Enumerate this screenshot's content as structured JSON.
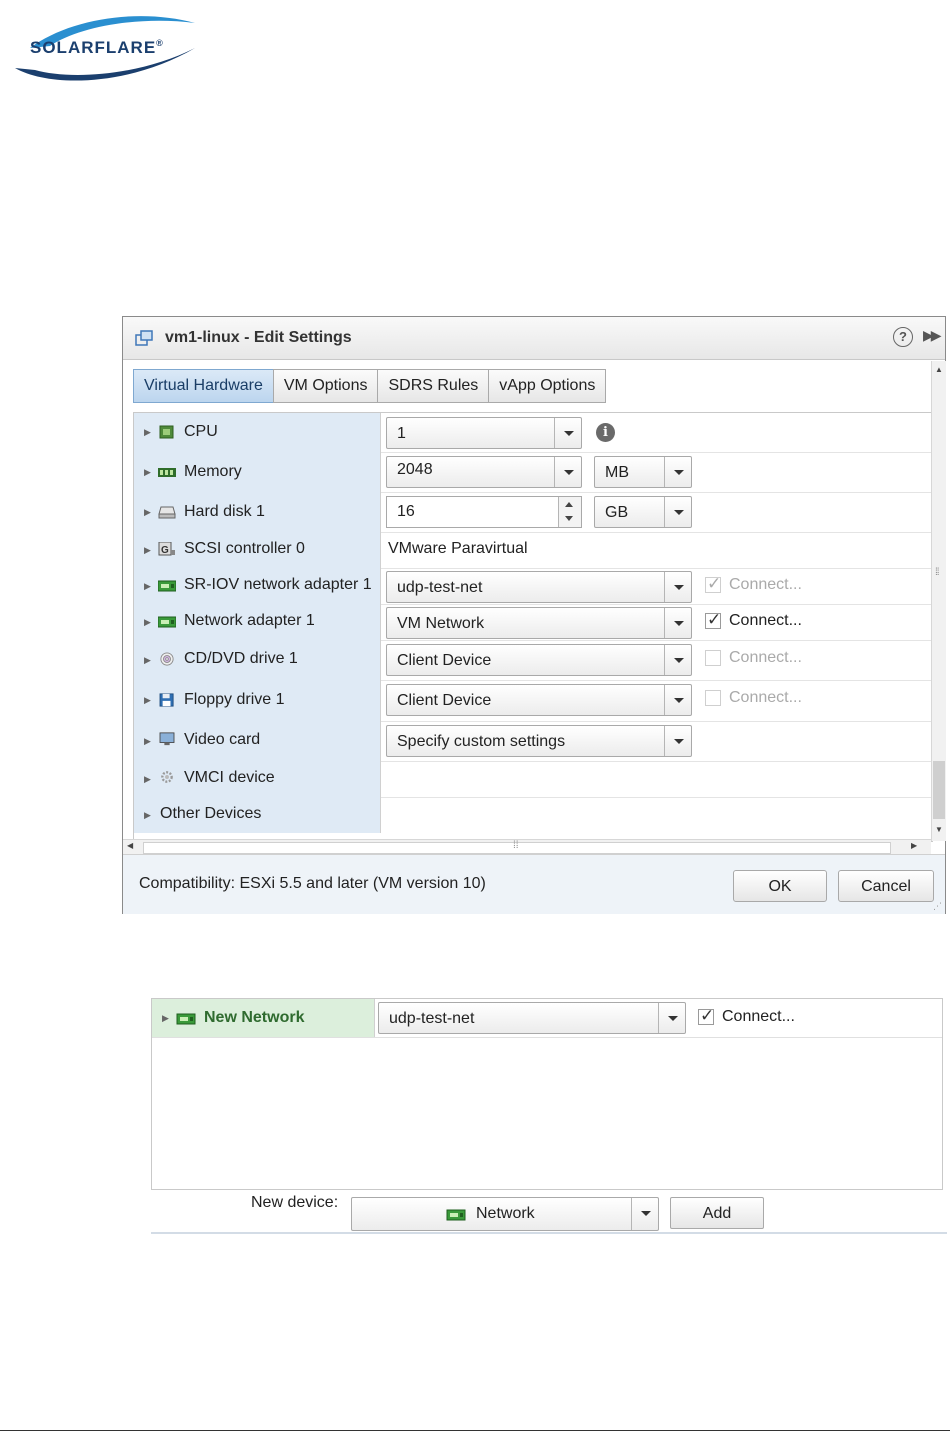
{
  "logo": {
    "text": "SOLARFLARE",
    "mark": "®"
  },
  "dialog": {
    "title": "vm1-linux - Edit Settings",
    "help_icon": "?",
    "tabs": [
      {
        "label": "Virtual Hardware",
        "active": true
      },
      {
        "label": "VM Options",
        "active": false
      },
      {
        "label": "SDRS Rules",
        "active": false
      },
      {
        "label": "vApp Options",
        "active": false
      }
    ],
    "devices": [
      {
        "label": "CPU",
        "icon": "cpu-icon",
        "value": "1"
      },
      {
        "label": "Memory",
        "icon": "memory-icon",
        "value": "2048",
        "unit": "MB"
      },
      {
        "label": "Hard disk 1",
        "icon": "hard-disk-icon",
        "value": "16",
        "unit": "GB"
      },
      {
        "label": "SCSI controller 0",
        "icon": "scsi-controller-icon",
        "value": "VMware Paravirtual"
      },
      {
        "label": "SR-IOV network adapter 1",
        "icon": "network-card-icon",
        "value": "udp-test-net",
        "connect": "Connect...",
        "connect_checked": true,
        "connect_disabled": true
      },
      {
        "label": "Network adapter 1",
        "icon": "network-card-icon",
        "value": "VM Network",
        "connect": "Connect...",
        "connect_checked": true,
        "connect_disabled": false
      },
      {
        "label": "CD/DVD drive 1",
        "icon": "cd-dvd-icon",
        "value": "Client Device",
        "connect": "Connect...",
        "connect_checked": false,
        "connect_disabled": true
      },
      {
        "label": "Floppy drive 1",
        "icon": "floppy-icon",
        "value": "Client Device",
        "connect": "Connect...",
        "connect_checked": false,
        "connect_disabled": true
      },
      {
        "label": "Video card",
        "icon": "video-card-icon",
        "value": "Specify custom settings"
      },
      {
        "label": "VMCI device",
        "icon": "vmci-gear-icon"
      },
      {
        "label": "Other Devices"
      }
    ],
    "compatibility": "Compatibility: ESXi 5.5 and later (VM version 10)",
    "ok_label": "OK",
    "cancel_label": "Cancel"
  },
  "new_device_panel": {
    "row_label": "New Network",
    "row_value": "udp-test-net",
    "connect": "Connect...",
    "connect_checked": true,
    "new_device_label": "New device:",
    "new_device_value": "Network",
    "add_label": "Add"
  },
  "colors": {
    "tab_active": "#bcd5ee",
    "label_column": "#dfeaf5",
    "new_row_highlight": "#dcefdc",
    "nic_green": "#3a9a3a"
  }
}
